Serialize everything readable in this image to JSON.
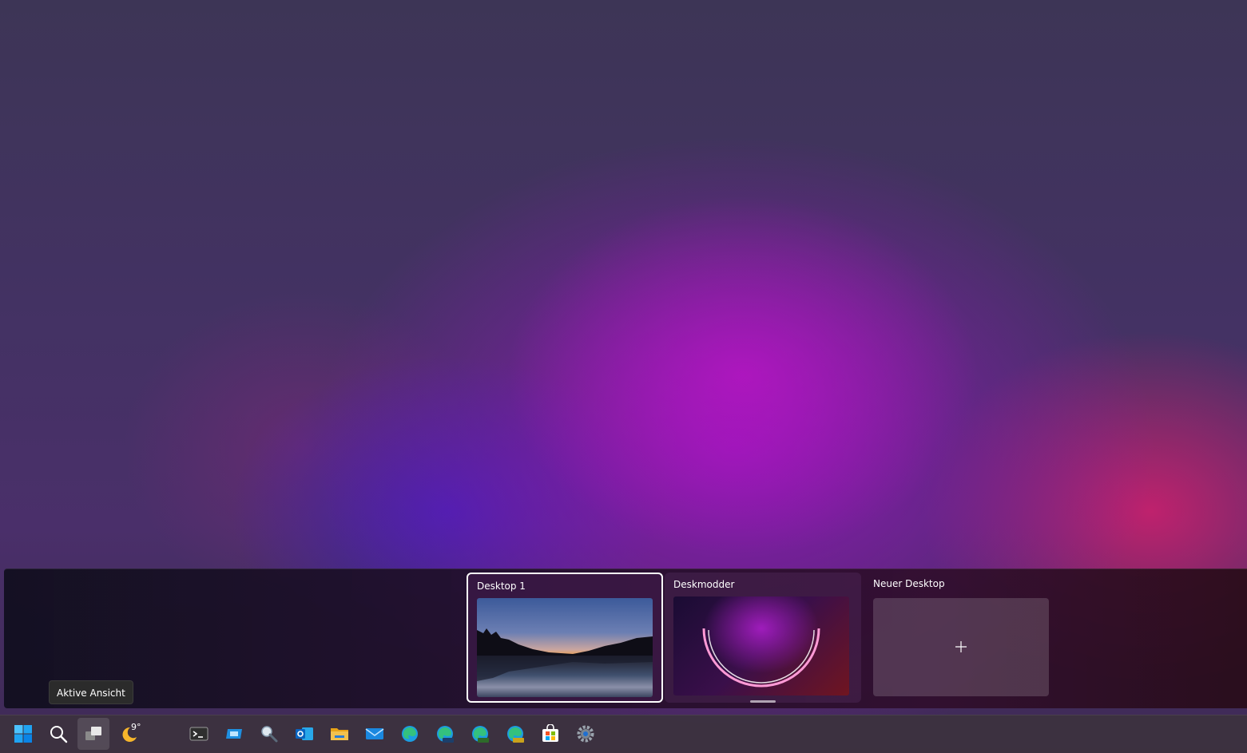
{
  "desktops": [
    {
      "label": "Desktop 1",
      "selected": true
    },
    {
      "label": "Deskmodder",
      "selected": false
    }
  ],
  "new_desktop": {
    "label": "Neuer Desktop"
  },
  "tooltip": "Aktive Ansicht",
  "weather": {
    "temperature": "9°"
  },
  "taskbar_icons": [
    "windows-start-icon",
    "search-icon",
    "task-view-icon",
    "weather-icon",
    "terminal-icon",
    "remote-desktop-icon",
    "magnifier-icon",
    "outlook-icon",
    "file-explorer-icon",
    "mail-icon",
    "edge-icon",
    "edge-beta-icon",
    "edge-dev-icon",
    "edge-canary-icon",
    "store-icon",
    "settings-icon"
  ],
  "colors": {
    "accent": "#0078d4",
    "folder": "#f2c14e"
  }
}
